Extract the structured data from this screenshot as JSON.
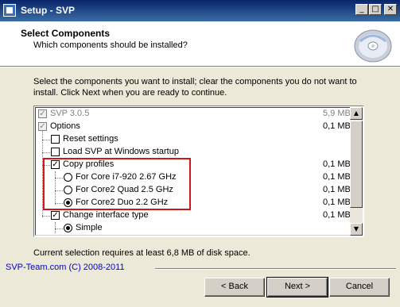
{
  "window": {
    "title": "Setup - SVP"
  },
  "titlebar_buttons": {
    "minimize": "_",
    "maximize": "□",
    "close": "✕"
  },
  "header": {
    "title": "Select Components",
    "subtitle": "Which components should be installed?",
    "logo_icon": "cd-disc-icon"
  },
  "instructions": "Select the components you want to install; clear the components you do not want to install. Click Next when you are ready to continue.",
  "components": [
    {
      "label": "SVP 3.0.5",
      "size": "5,9 MB",
      "control": "checkbox",
      "checked": true,
      "disabled": true
    },
    {
      "label": "Options",
      "size": "0,1 MB",
      "control": "checkbox",
      "checked": true,
      "disabled": false
    },
    {
      "label": "Reset settings",
      "size": "",
      "control": "checkbox",
      "checked": false
    },
    {
      "label": "Load SVP at Windows startup",
      "size": "",
      "control": "checkbox",
      "checked": false
    },
    {
      "label": "Copy profiles",
      "size": "0,1 MB",
      "control": "checkbox",
      "checked": true
    },
    {
      "label": "For Core i7-920 2.67 GHz",
      "size": "0,1 MB",
      "control": "radio",
      "checked": false
    },
    {
      "label": "For Core2 Quad 2.5 GHz",
      "size": "0,1 MB",
      "control": "radio",
      "checked": false
    },
    {
      "label": "For Core2 Duo 2.2 GHz",
      "size": "0,1 MB",
      "control": "radio",
      "checked": true
    },
    {
      "label": "Change interface type",
      "size": "0,1 MB",
      "control": "checkbox",
      "checked": true
    },
    {
      "label": "Simple",
      "size": "",
      "control": "radio",
      "checked": true
    }
  ],
  "space_note": "Current selection requires at least 6,8 MB of disk space.",
  "brand": "SVP-Team.com (C) 2008-2011",
  "buttons": {
    "back": "< Back",
    "next": "Next >",
    "cancel": "Cancel"
  },
  "scrollbar": {
    "up": "▲",
    "down": "▼"
  },
  "colors": {
    "highlight_box": "#d01818",
    "brand_link": "#0000cc",
    "title_bar": "#0a246a"
  }
}
